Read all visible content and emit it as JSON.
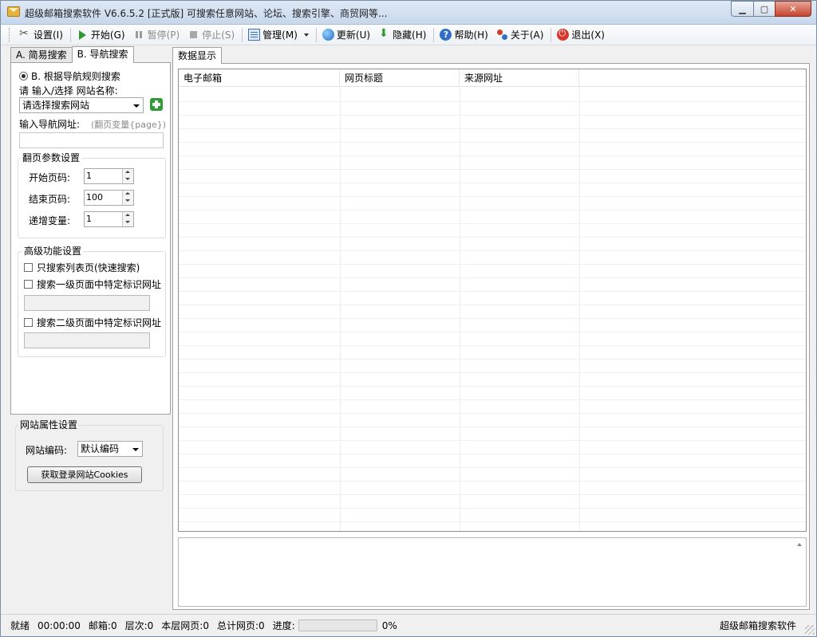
{
  "window": {
    "title": "超级邮箱搜索软件 V6.6.5.2  [正式版]  可搜索任意网站、论坛、搜索引擎、商贸网等...",
    "controls": {
      "minimize": "▁",
      "maximize": "▢",
      "close": "✕"
    }
  },
  "toolbar": {
    "settings": "设置(I)",
    "start": "开始(G)",
    "pause": "暂停(P)",
    "stop": "停止(S)",
    "manage": "管理(M)",
    "update": "更新(U)",
    "hide": "隐藏(H)",
    "help": "帮助(H)",
    "about": "关于(A)",
    "exit": "退出(X)"
  },
  "left_tabs": {
    "simple": "A. 简易搜索",
    "nav": "B. 导航搜索"
  },
  "nav_search": {
    "radio_label": "B. 根据导航规则搜索",
    "site_name_label": "请 输入/选择 网站名称:",
    "site_select_value": "请选择搜索网站",
    "nav_url_label": "输入导航网址:",
    "nav_url_hint": "(翻页变量{page})",
    "nav_url_value": ""
  },
  "paging": {
    "title": "翻页参数设置",
    "start_label": "开始页码:",
    "start_value": "1",
    "end_label": "结束页码:",
    "end_value": "100",
    "step_label": "递增变量:",
    "step_value": "1"
  },
  "advanced": {
    "title": "高级功能设置",
    "opt_list_only": "只搜索列表页(快速搜索)",
    "opt_level1": "搜索一级页面中特定标识网址",
    "opt_level2": "搜索二级页面中特定标识网址",
    "level1_value": "",
    "level2_value": ""
  },
  "site_props": {
    "title": "网站属性设置",
    "encoding_label": "网站编码:",
    "encoding_value": "默认编码",
    "cookies_button": "获取登录网站Cookies"
  },
  "data_tab": "数据显示",
  "grid": {
    "columns": [
      "电子邮箱",
      "网页标题",
      "来源网址",
      ""
    ],
    "rows": []
  },
  "log_text": "",
  "status": {
    "ready": "就绪",
    "time": "00:00:00",
    "mailbox": "邮箱:0",
    "depth": "层次:0",
    "layer_pages": "本层网页:0",
    "total_pages": "总计网页:0",
    "progress_label": "进度:",
    "progress_fraction": 0,
    "progress_text": "0%",
    "brand": "超级邮箱搜索软件"
  },
  "colors": {
    "title_bar": "#c6d7ec",
    "close_button": "#c7442d",
    "start_icon": "#2e9a2e",
    "add_icon": "#2f9b37",
    "progress_fill": "#3db23d"
  },
  "icons": {
    "app": "mail-envelope-icon",
    "settings": "scissors-tools-icon",
    "start": "play-icon",
    "pause": "pause-icon",
    "stop": "stop-icon",
    "manage": "list-document-icon",
    "update": "globe-refresh-icon",
    "hide": "download-arrow-icon",
    "help": "question-circle-icon",
    "about": "people-icon",
    "exit": "power-icon",
    "add_site": "plus-icon"
  }
}
